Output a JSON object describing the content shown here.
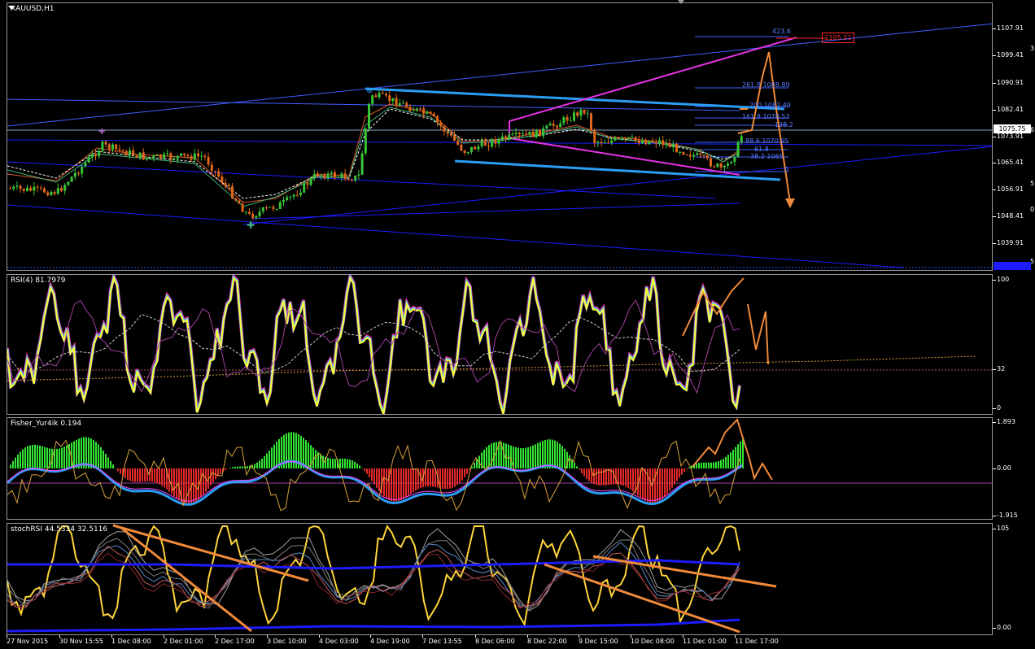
{
  "window": {
    "symbol": "XAUUSD,H1"
  },
  "main_chart": {
    "current_price": "1075.75",
    "price_ticks": [
      "1107.91",
      "1099.41",
      "1090.91",
      "1082.41",
      "1073.91",
      "1065.41",
      "1056.91",
      "1048.41",
      "1039.91"
    ],
    "right_edge_partials": [
      "3",
      "6",
      "5",
      "0",
      "5"
    ],
    "target_price": "1105.21",
    "fib_labels": [
      "423.6",
      "261.8 1088.89",
      "200 1082.49",
      "161.8 1078.53",
      "138.2",
      "88.6 1070.95",
      "61.8",
      "38.2 1065",
      "0"
    ],
    "colors": {
      "candle_up": "#39c439",
      "candle_down": "#e0661a",
      "channel": "#2a9df4",
      "wedge": "#ff33ff",
      "trend": "#1c1cff",
      "forecast": "#f08a3a"
    }
  },
  "rsi_panel": {
    "title": "RSI(4) 81.7979",
    "ticks": [
      "100",
      "32",
      "0"
    ]
  },
  "fisher_panel": {
    "title": "Fisher_Yur4ik 0.194",
    "ticks": [
      "1.893",
      "0.00",
      "-1.915"
    ]
  },
  "stoch_panel": {
    "title": "stochRSI 44.5334 32.5116",
    "ticks": [
      "105",
      "0.00"
    ]
  },
  "time_axis": [
    "27 Nov 2015",
    "30 Nov 15:55",
    "1 Dec 08:00",
    "2 Dec 01:00",
    "2 Dec 17:00",
    "3 Dec 10:00",
    "4 Dec 03:00",
    "4 Dec 19:00",
    "7 Dec 13:55",
    "8 Dec 06:00",
    "8 Dec 22:00",
    "9 Dec 15:00",
    "10 Dec 08:00",
    "11 Dec 01:00",
    "11 Dec 17:00"
  ]
}
